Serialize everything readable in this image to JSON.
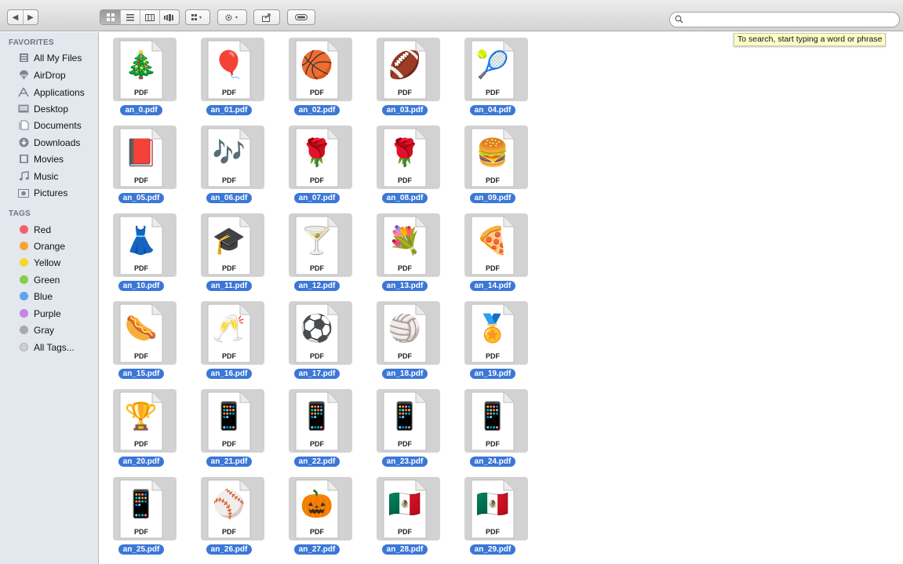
{
  "toolbar": {
    "nav": [
      "◀",
      "▶"
    ],
    "view_buttons": [
      "icon-view",
      "list-view",
      "column-view",
      "coverflow-view"
    ],
    "search_value": "",
    "tooltip": "To search, start typing a word or phrase"
  },
  "sidebar": {
    "favorites_heading": "FAVORITES",
    "favorites": [
      {
        "label": "All My Files",
        "icon": "all-files-icon"
      },
      {
        "label": "AirDrop",
        "icon": "airdrop-icon"
      },
      {
        "label": "Applications",
        "icon": "applications-icon"
      },
      {
        "label": "Desktop",
        "icon": "desktop-icon"
      },
      {
        "label": "Documents",
        "icon": "documents-icon"
      },
      {
        "label": "Downloads",
        "icon": "downloads-icon"
      },
      {
        "label": "Movies",
        "icon": "movies-icon"
      },
      {
        "label": "Music",
        "icon": "music-icon"
      },
      {
        "label": "Pictures",
        "icon": "pictures-icon"
      }
    ],
    "tags_heading": "TAGS",
    "tags": [
      {
        "label": "Red",
        "color": "#f2616a"
      },
      {
        "label": "Orange",
        "color": "#f7a531"
      },
      {
        "label": "Yellow",
        "color": "#f4d82e"
      },
      {
        "label": "Green",
        "color": "#84cf4b"
      },
      {
        "label": "Blue",
        "color": "#5ba6ee"
      },
      {
        "label": "Purple",
        "color": "#c983e5"
      },
      {
        "label": "Gray",
        "color": "#a9a9a9"
      },
      {
        "label": "All Tags...",
        "color": "#cfcfcf"
      }
    ]
  },
  "files": [
    {
      "name": "an_0.pdf",
      "art": "🎄"
    },
    {
      "name": "an_01.pdf",
      "art": "🎈"
    },
    {
      "name": "an_02.pdf",
      "art": "🏀"
    },
    {
      "name": "an_03.pdf",
      "art": "🏈"
    },
    {
      "name": "an_04.pdf",
      "art": "🎾"
    },
    {
      "name": "an_05.pdf",
      "art": "📕"
    },
    {
      "name": "an_06.pdf",
      "art": "🎶"
    },
    {
      "name": "an_07.pdf",
      "art": "🌹"
    },
    {
      "name": "an_08.pdf",
      "art": "🌹"
    },
    {
      "name": "an_09.pdf",
      "art": "🍔"
    },
    {
      "name": "an_10.pdf",
      "art": "👗"
    },
    {
      "name": "an_11.pdf",
      "art": "🎓"
    },
    {
      "name": "an_12.pdf",
      "art": "🍸"
    },
    {
      "name": "an_13.pdf",
      "art": "💐"
    },
    {
      "name": "an_14.pdf",
      "art": "🍕"
    },
    {
      "name": "an_15.pdf",
      "art": "🌭"
    },
    {
      "name": "an_16.pdf",
      "art": "🥂"
    },
    {
      "name": "an_17.pdf",
      "art": "⚽"
    },
    {
      "name": "an_18.pdf",
      "art": "🏐"
    },
    {
      "name": "an_19.pdf",
      "art": "🏅"
    },
    {
      "name": "an_20.pdf",
      "art": "🏆"
    },
    {
      "name": "an_21.pdf",
      "art": "📱"
    },
    {
      "name": "an_22.pdf",
      "art": "📱"
    },
    {
      "name": "an_23.pdf",
      "art": "📱"
    },
    {
      "name": "an_24.pdf",
      "art": "📱"
    },
    {
      "name": "an_25.pdf",
      "art": "📱"
    },
    {
      "name": "an_26.pdf",
      "art": "⚾"
    },
    {
      "name": "an_27.pdf",
      "art": "🎃"
    },
    {
      "name": "an_28.pdf",
      "art": "🇲🇽"
    },
    {
      "name": "an_29.pdf",
      "art": "🇲🇽"
    }
  ],
  "pdf_label": "PDF"
}
